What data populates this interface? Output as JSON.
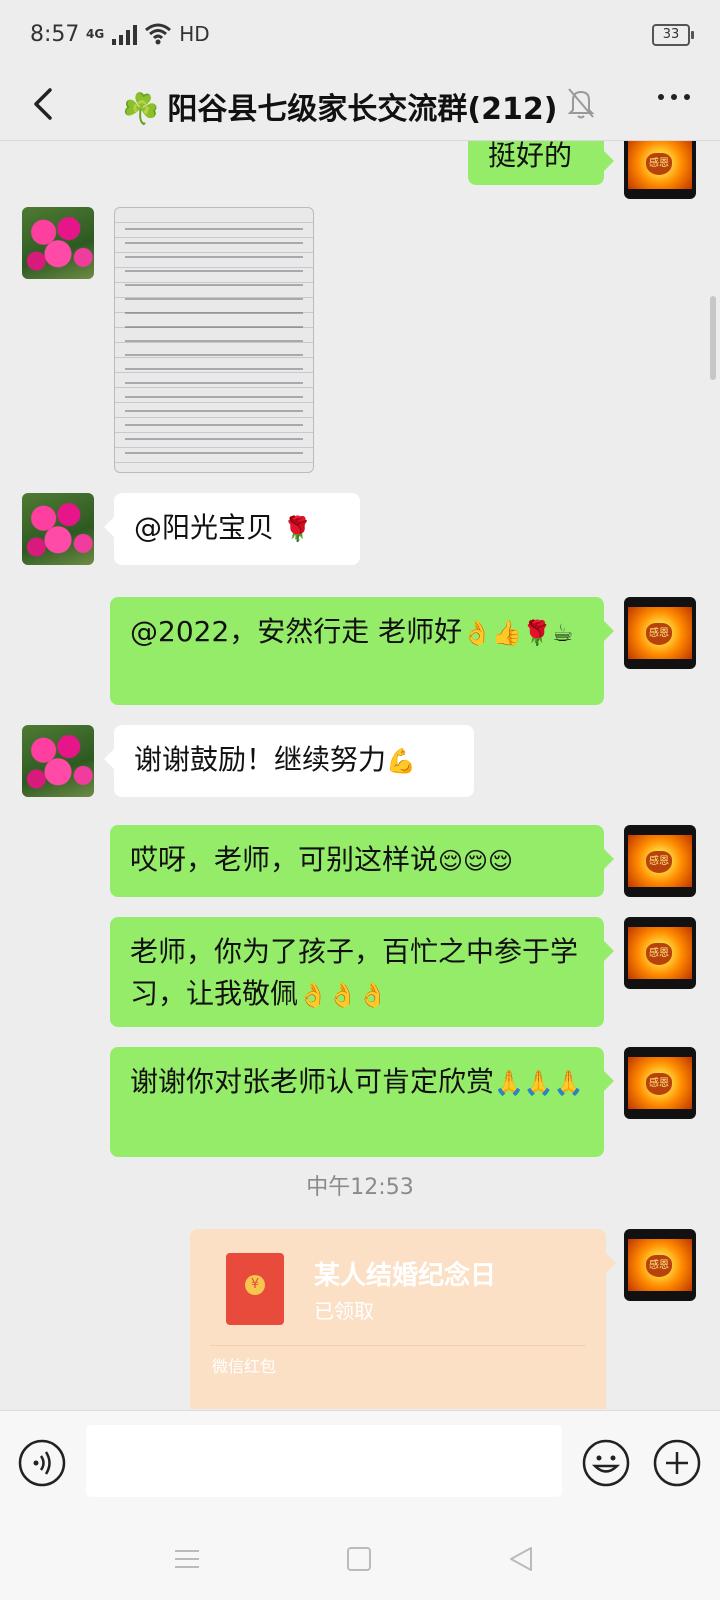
{
  "status_bar": {
    "time": "8:57",
    "network": "4G",
    "signal": "HD",
    "battery": "33"
  },
  "header": {
    "title": "阳谷县七级家长交流群(212)",
    "title_icon": "clover-emoji",
    "back_icon": "chevron-left-icon",
    "mute_icon": "bell-off-icon",
    "more_icon": "more-dots-icon"
  },
  "messages": [
    {
      "side": "right",
      "text": "挺好的"
    },
    {
      "side": "left",
      "type": "image",
      "description": "photo-of-handwritten-notes"
    },
    {
      "side": "left",
      "text": "@阳光宝贝 ",
      "emoji": "🌹"
    },
    {
      "side": "right",
      "text": "@2022，安然行走  老师好",
      "emoji": "👌👍🌹☕"
    },
    {
      "side": "left",
      "text": "谢谢鼓励！继续努力",
      "emoji": "💪"
    },
    {
      "side": "right",
      "text": "哎呀，老师，可别这样说",
      "emoji": "😌😌😌"
    },
    {
      "side": "right",
      "text": "老师，你为了孩子，百忙之中参于学习，让我敬佩",
      "emoji": "👌👌👌"
    },
    {
      "side": "right",
      "text": "谢谢你对张老师认可肯定欣赏",
      "emoji": "🙏🙏🙏"
    }
  ],
  "time_label": "中午12:53",
  "red_packet": {
    "title": "某人结婚纪念日",
    "status": "已领取",
    "footer": "微信红包",
    "coin_symbol": "¥"
  },
  "avatar_text": "感恩",
  "input_bar": {
    "voice_icon": "voice-icon",
    "emoji_icon": "emoji-icon",
    "plus_icon": "plus-icon",
    "placeholder": ""
  },
  "nav_bar": {
    "menu_icon": "menu-icon",
    "home_icon": "home-icon",
    "back_icon": "back-triangle-icon"
  },
  "colors": {
    "background": "#ededed",
    "bubble_self": "#95ec69",
    "bubble_other": "#ffffff",
    "red_packet": "#fbe0c6"
  }
}
